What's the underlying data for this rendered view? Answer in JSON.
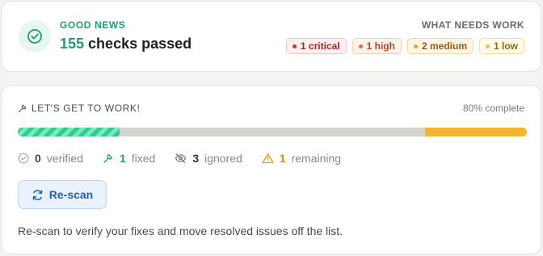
{
  "summary": {
    "kicker": "GOOD NEWS",
    "passed_count": "155",
    "passed_suffix": " checks passed",
    "needs_label": "WHAT NEEDS WORK",
    "severities": [
      {
        "label": "1 critical",
        "color": "#d92f2f"
      },
      {
        "label": "1 high",
        "color": "#e8713a"
      },
      {
        "label": "2 medium",
        "color": "#f0a02a"
      },
      {
        "label": "1 low",
        "color": "#e8c23a"
      }
    ]
  },
  "work": {
    "title": "LET'S GET TO WORK!",
    "complete_text": "80% complete",
    "progress": {
      "fixed_fraction": 0.2,
      "remaining_fraction": 0.2
    },
    "stats": {
      "verified": {
        "count": "0",
        "label": "verified"
      },
      "fixed": {
        "count": "1",
        "label": "fixed"
      },
      "ignored": {
        "count": "3",
        "label": "ignored"
      },
      "remaining": {
        "count": "1",
        "label": "remaining"
      }
    },
    "rescan_label": "Re-scan",
    "hint": "Re-scan to verify your fixes and move resolved issues off the list."
  },
  "colors": {
    "success": "#1f9d74",
    "accent": "#1d62b8",
    "warning": "#d98a0e"
  }
}
